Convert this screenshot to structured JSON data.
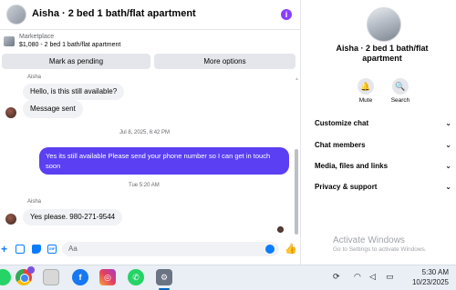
{
  "header": {
    "title": "Aisha · 2 bed 1 bath/flat apartment",
    "info_icon": "info-icon"
  },
  "marketplace": {
    "label": "Marketplace",
    "listing": "$1,080 - 2 bed 1 bath/flat apartment",
    "pending_button": "Mark as pending",
    "more_button": "More options"
  },
  "messages": {
    "sender_top": "Aisha",
    "msg1": "Hello, is this still available?",
    "msg2": "Message sent",
    "time1": "Jul 8, 2025, 6:42 PM",
    "outgoing": "Yes its still available Please send your phone number so I can get in touch soon",
    "time2": "Tue 5:20 AM",
    "sender2": "Aisha",
    "msg3": "Yes please. 980-271-9544"
  },
  "composer": {
    "placeholder": "Aa"
  },
  "details": {
    "name": "Aisha · 2 bed 1 bath/flat apartment",
    "mute": "Mute",
    "search": "Search",
    "sections": [
      "Customize chat",
      "Chat members",
      "Media, files and links",
      "Privacy & support"
    ]
  },
  "watermark": {
    "line1": "Activate Windows",
    "line2": "Go to Settings to activate Windows."
  },
  "taskbar": {
    "time": "5:30 AM",
    "date": "10/23/2025"
  },
  "colors": {
    "accent": "#5b3ff2",
    "messenger_blue": "#0a7cff"
  }
}
